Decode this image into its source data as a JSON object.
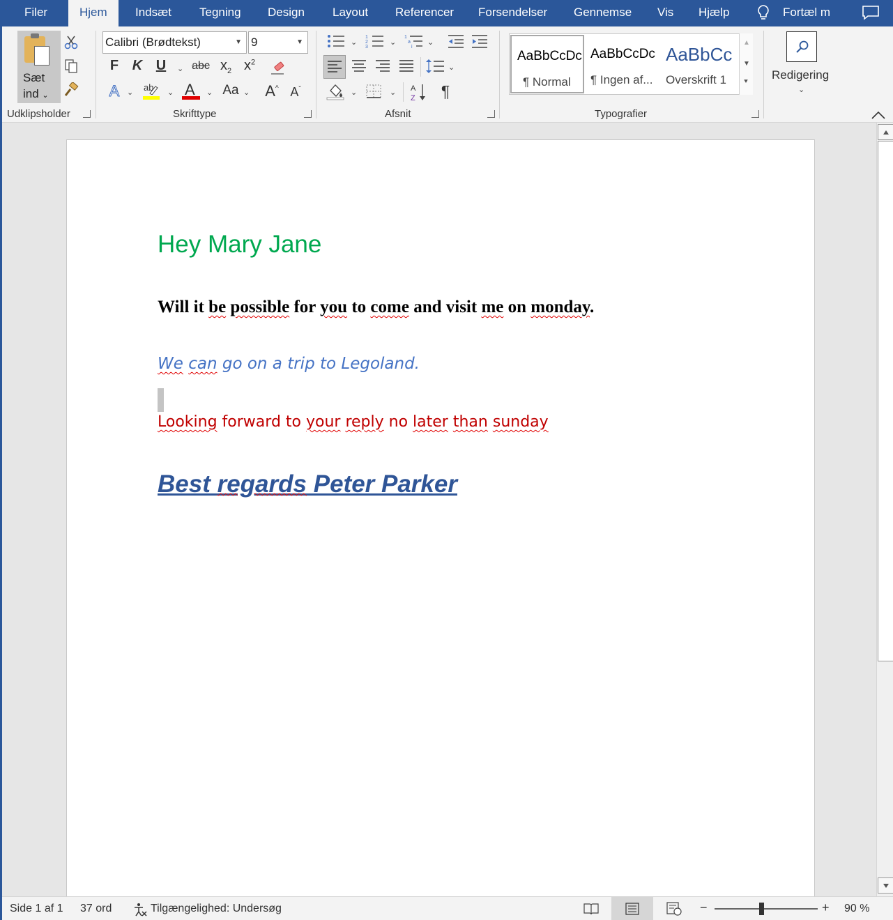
{
  "tabs": [
    {
      "label": "Filer",
      "active": false
    },
    {
      "label": "Hjem",
      "active": true
    },
    {
      "label": "Indsæt",
      "active": false
    },
    {
      "label": "Tegning",
      "active": false
    },
    {
      "label": "Design",
      "active": false
    },
    {
      "label": "Layout",
      "active": false
    },
    {
      "label": "Referencer",
      "active": false
    },
    {
      "label": "Forsendelser",
      "active": false
    },
    {
      "label": "Gennemse",
      "active": false
    },
    {
      "label": "Vis",
      "active": false
    },
    {
      "label": "Hjælp",
      "active": false
    }
  ],
  "tell_me": "Fortæl m",
  "clipboard": {
    "paste_line1": "Sæt",
    "paste_line2": "ind",
    "group_label": "Udklipsholder"
  },
  "font": {
    "name": "Calibri (Brødtekst)",
    "size": "9",
    "group_label": "Skrifttype",
    "bold": "F",
    "italic": "K",
    "underline": "U",
    "strike": "abc",
    "sub": "x",
    "sub2": "2",
    "sup": "x",
    "sup2": "2",
    "case": "Aa",
    "grow": "A",
    "shrink": "A",
    "highlight_label": "ab"
  },
  "paragraph": {
    "group_label": "Afsnit",
    "pilcrow": "¶"
  },
  "styles": {
    "group_label": "Typografier",
    "items": [
      {
        "preview": "AaBbCcDc",
        "name": "¶ Normal"
      },
      {
        "preview": "AaBbCcDc",
        "name": "¶ Ingen af..."
      },
      {
        "preview": "AaBbCc",
        "name": "Overskrift 1"
      }
    ]
  },
  "editing": {
    "label": "Redigering"
  },
  "document": {
    "greeting": "Hey Mary Jane",
    "question_parts": [
      "Will it ",
      "be",
      " ",
      "possible",
      " for ",
      "you",
      " to ",
      "come",
      " and visit ",
      "me",
      " on ",
      "monday",
      "."
    ],
    "trip_parts": [
      "We",
      " ",
      "can",
      " go on a trip to Legoland."
    ],
    "reply_parts": [
      "Looking",
      " forward to ",
      "your",
      " ",
      "reply",
      " no ",
      "later",
      " ",
      "than",
      " ",
      "sunday"
    ],
    "sign_parts": [
      "Best ",
      "regards",
      " Peter Parker"
    ]
  },
  "status": {
    "page": "Side 1 af 1",
    "words": "37 ord",
    "accessibility": "Tilgængelighed: Undersøg",
    "zoom": "90 %",
    "zoom_minus": "−",
    "zoom_plus": "+"
  },
  "colors": {
    "brand": "#2b579a",
    "greeting": "#00a84f",
    "trip": "#4472c4",
    "reply": "#c00000",
    "signature": "#2f5597"
  }
}
